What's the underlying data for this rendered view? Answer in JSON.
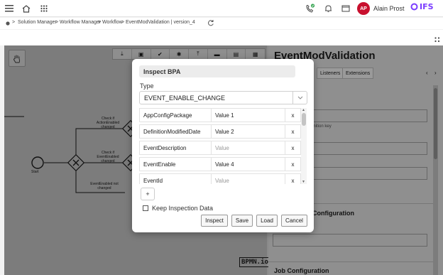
{
  "header": {
    "user_initials": "AP",
    "user_name": "Alain Prost",
    "logo_text": "IFS",
    "notification_color": "#3aa655",
    "logo_color": "#7a3cff",
    "avatar_color": "#c8102e"
  },
  "breadcrumb": {
    "items": [
      "Solution Manager",
      "Workflow Manager",
      "Workflow",
      "EventModValidation | version_4"
    ],
    "separator": ">"
  },
  "canvas": {
    "bpmn_io_label": "BPMN.io",
    "start_label": "Start",
    "edge_labels": [
      "Check if ActionEnabled changed",
      "Check if EventEnabled changed",
      "EventEnabled not changed"
    ]
  },
  "properties": {
    "title": "EventModValidation",
    "tabs": [
      "Listeners",
      "Extensions"
    ],
    "field_value": "ation",
    "hint": "ss definition key",
    "section_1": "Configuration",
    "section_2": "Job Configuration"
  },
  "modal": {
    "title": "Inspect BPA",
    "type_label": "Type",
    "type_value": "EVENT_ENABLE_CHANGE",
    "rows": [
      {
        "key": "AppConfigPackage",
        "value": "Value 1",
        "placeholder": false
      },
      {
        "key": "DefinitionModifiedDate",
        "value": "Value 2",
        "placeholder": false
      },
      {
        "key": "EventDescription",
        "value": "Value",
        "placeholder": true
      },
      {
        "key": "EventEnable",
        "value": "Value 4",
        "placeholder": false
      },
      {
        "key": "EventId",
        "value": "Value",
        "placeholder": true
      }
    ],
    "remove_label": "x",
    "add_label": "+",
    "keep_label": "Keep Inspection Data",
    "buttons": {
      "inspect": "Inspect",
      "save": "Save",
      "load": "Load",
      "cancel": "Cancel"
    }
  }
}
